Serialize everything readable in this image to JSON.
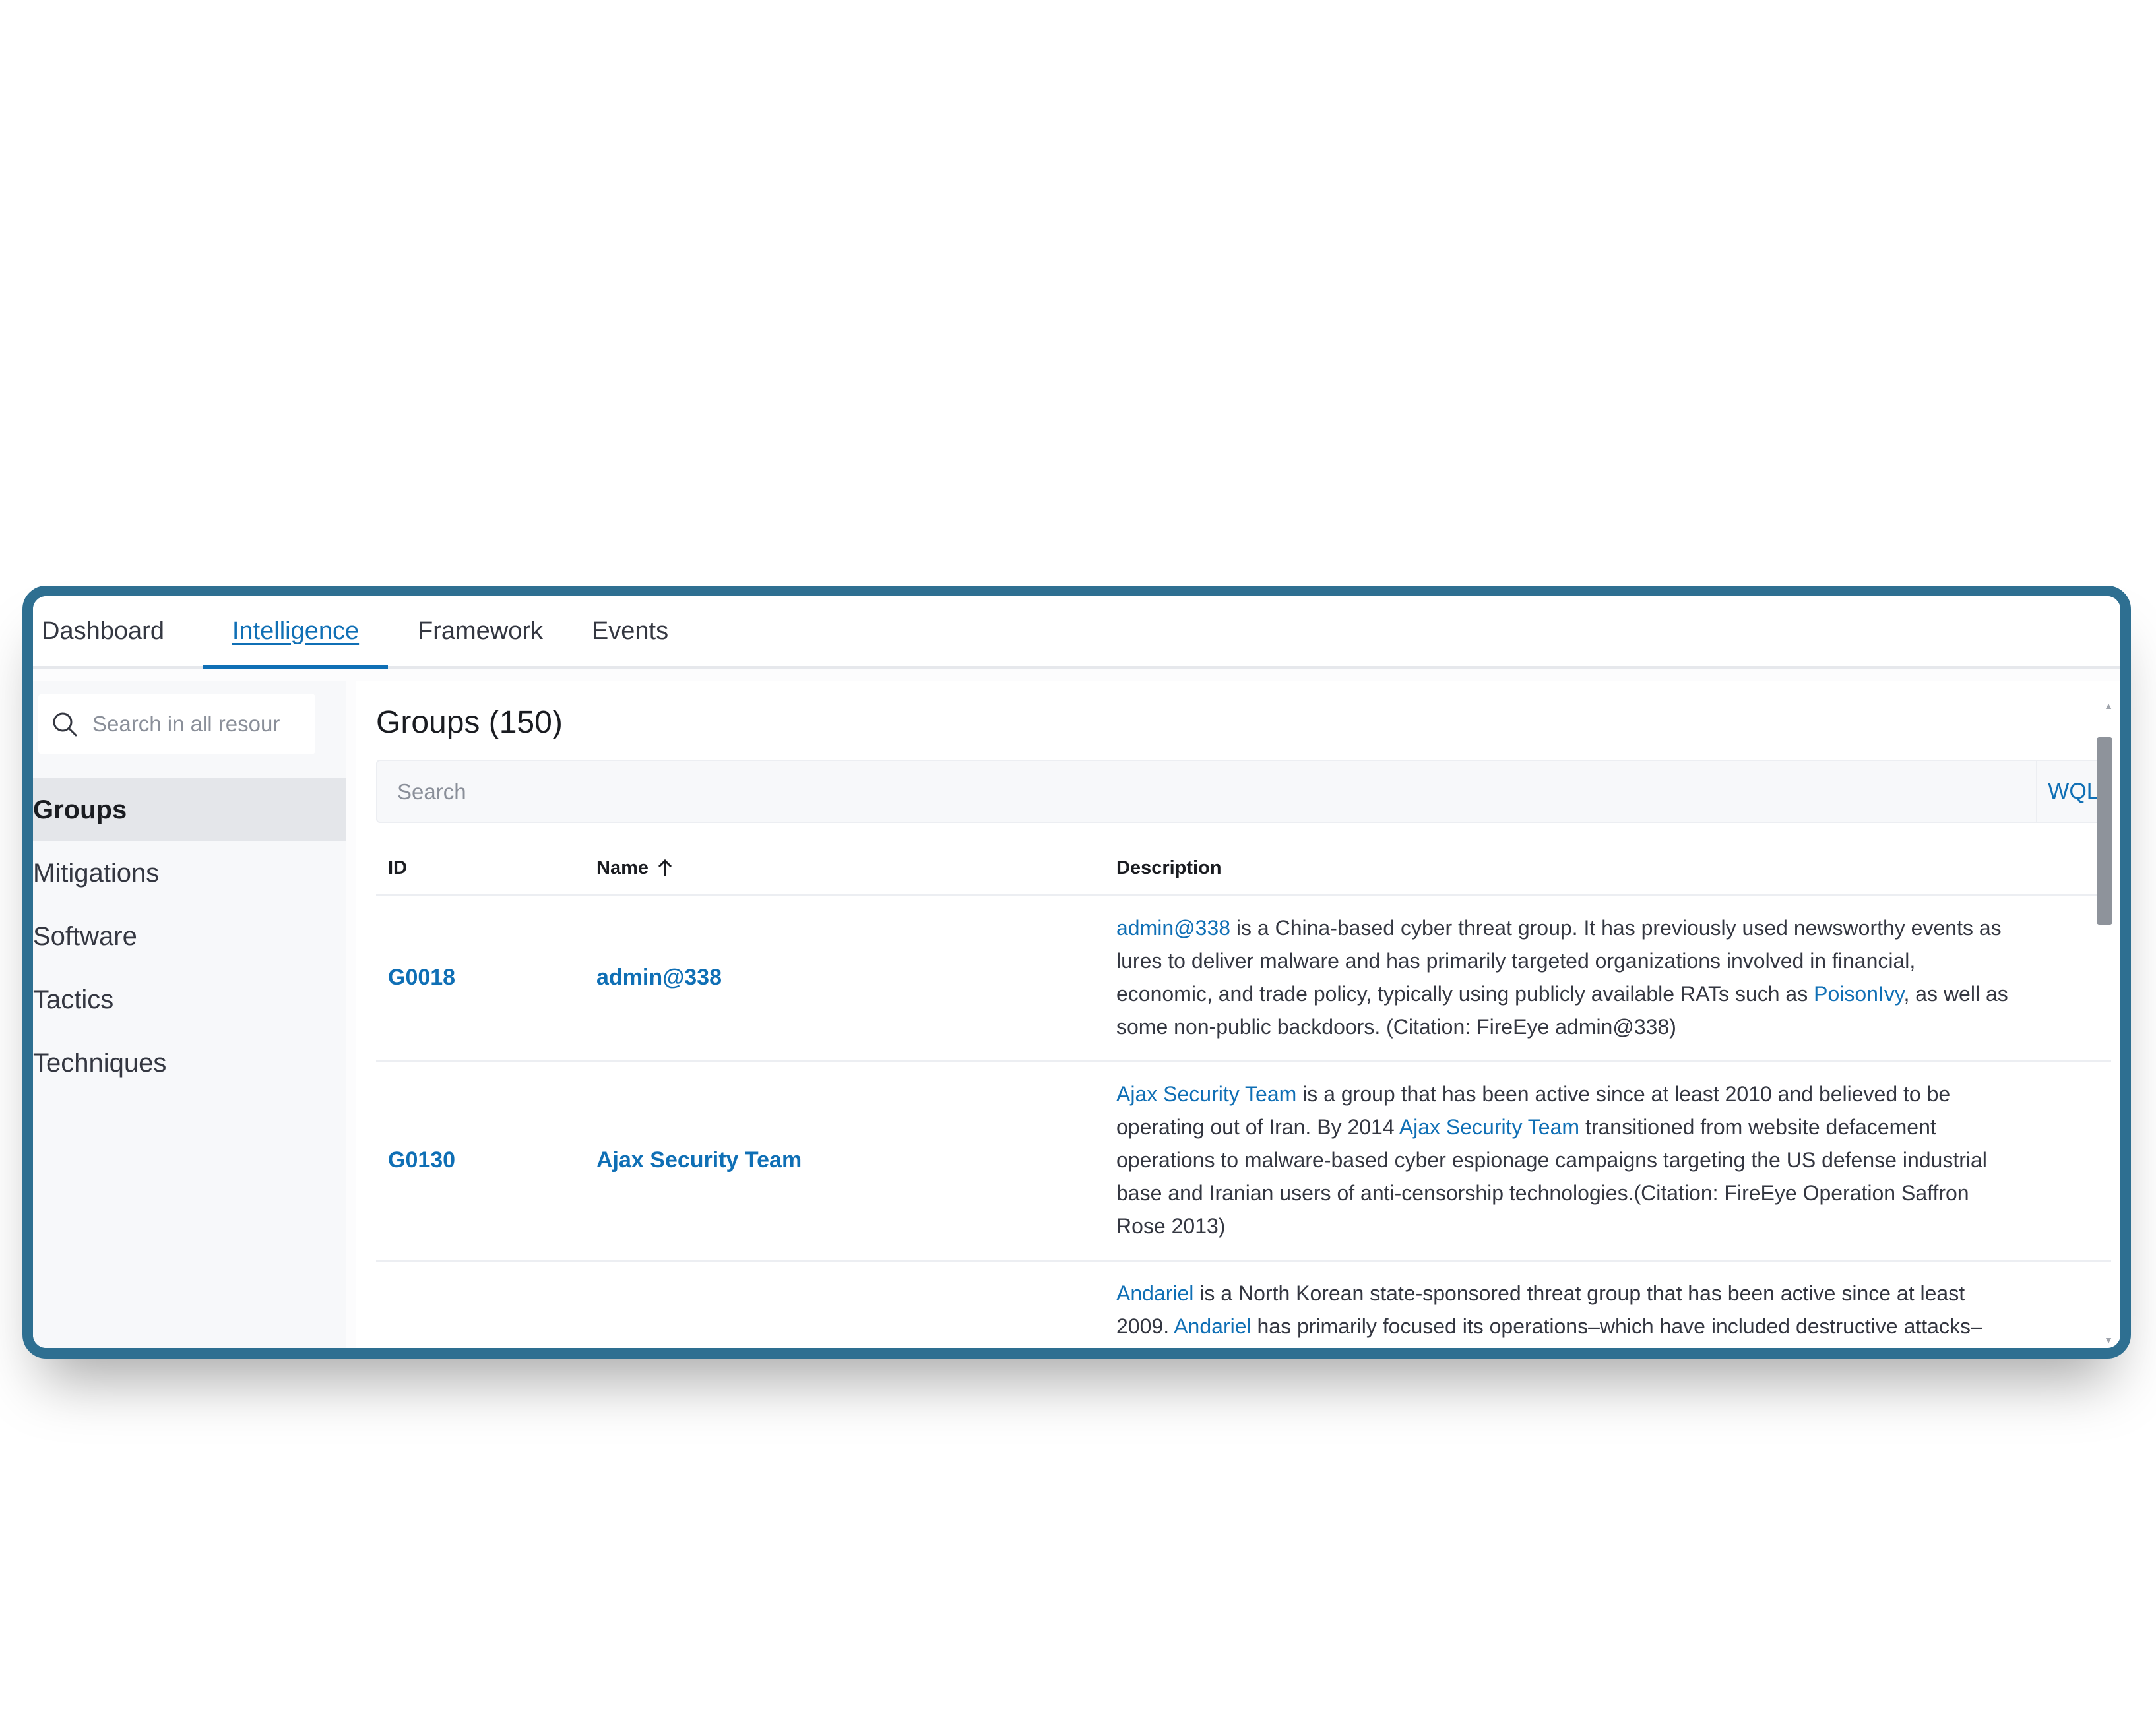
{
  "tabs": [
    {
      "label": "Dashboard",
      "active": false
    },
    {
      "label": "Intelligence",
      "active": true
    },
    {
      "label": "Framework",
      "active": false
    },
    {
      "label": "Events",
      "active": false
    }
  ],
  "sidebar": {
    "search_placeholder": "Search in all resour",
    "items": [
      {
        "label": "Groups",
        "active": true
      },
      {
        "label": "Mitigations",
        "active": false
      },
      {
        "label": "Software",
        "active": false
      },
      {
        "label": "Tactics",
        "active": false
      },
      {
        "label": "Techniques",
        "active": false
      }
    ]
  },
  "main": {
    "title": "Groups (150)",
    "search_placeholder": "Search",
    "wql_label": "WQL",
    "columns": {
      "id": "ID",
      "name": "Name",
      "description": "Description"
    },
    "rows": [
      {
        "id": "G0018",
        "name": "admin@338",
        "desc": {
          "l1a": "admin@338",
          "l1b": " is a China-based cyber threat group. It has previously used newsworthy events as",
          "l2": "lures to deliver malware and has primarily targeted organizations involved in financial,",
          "l3a": "economic, and trade policy, typically using publicly available RATs such as ",
          "l3b": "PoisonIvy",
          "l3c": ", as well as",
          "l4": "some non-public backdoors. (Citation: FireEye admin@338)"
        }
      },
      {
        "id": "G0130",
        "name": "Ajax Security Team",
        "desc": {
          "l1a": "Ajax Security Team",
          "l1b": " is a group that has been active since at least 2010 and believed to be",
          "l2a": "operating out of Iran. By 2014 ",
          "l2b": "Ajax Security Team",
          "l2c": " transitioned from website defacement",
          "l3": "operations to malware-based cyber espionage campaigns targeting the US defense industrial",
          "l4": "base and Iranian users of anti-censorship technologies.(Citation: FireEye Operation Saffron",
          "l5": "Rose 2013)"
        }
      },
      {
        "desc": {
          "l1a": "Andariel",
          "l1b": " is a North Korean state-sponsored threat group that has been active since at least",
          "l2a": "2009. ",
          "l2b": "Andariel",
          "l2c": " has primarily focused its operations–which have included destructive attacks–"
        }
      }
    ]
  },
  "colors": {
    "frame": "#2e6f91",
    "link": "#0f6fb5",
    "text": "#343741"
  },
  "icons": {
    "search": "search-icon",
    "sort": "arrow-up-icon"
  }
}
